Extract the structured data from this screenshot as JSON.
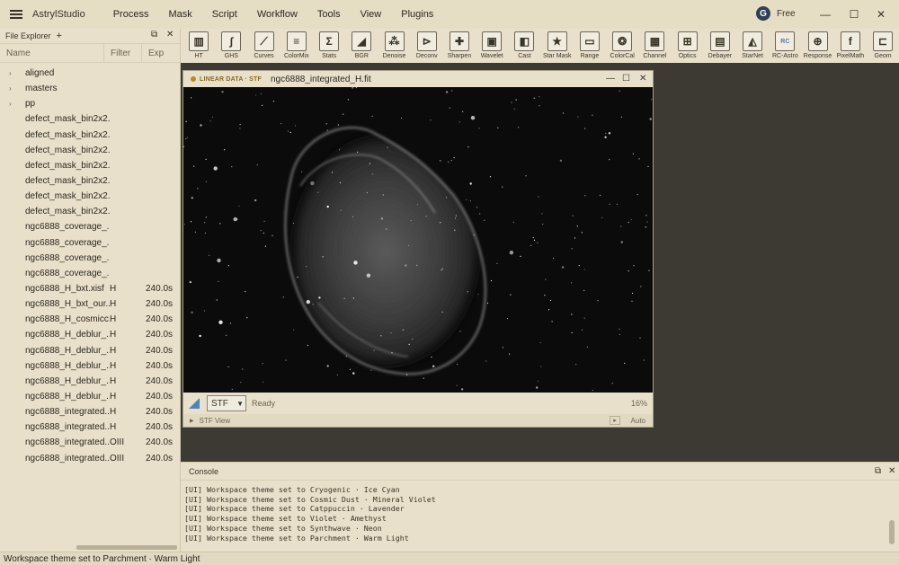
{
  "app": {
    "title": "AstrylStudio"
  },
  "menu": [
    "Process",
    "Mask",
    "Script",
    "Workflow",
    "Tools",
    "View",
    "Plugins"
  ],
  "user": {
    "initial": "G",
    "plan": "Free"
  },
  "window_controls": {
    "minimize": "—",
    "maximize": "☐",
    "close": "✕"
  },
  "file_explorer": {
    "title": "File Explorer",
    "add_icon": "+",
    "columns": {
      "name": "Name",
      "filter": "Filter",
      "exp": "Exp"
    },
    "items": [
      {
        "name": "aligned",
        "folder": true,
        "filter": "",
        "exp": ""
      },
      {
        "name": "masters",
        "folder": true,
        "filter": "",
        "exp": ""
      },
      {
        "name": "pp",
        "folder": true,
        "filter": "",
        "exp": ""
      },
      {
        "name": "defect_mask_bin2x2...",
        "folder": false,
        "filter": "",
        "exp": ""
      },
      {
        "name": "defect_mask_bin2x2...",
        "folder": false,
        "filter": "",
        "exp": ""
      },
      {
        "name": "defect_mask_bin2x2...",
        "folder": false,
        "filter": "",
        "exp": ""
      },
      {
        "name": "defect_mask_bin2x2...",
        "folder": false,
        "filter": "",
        "exp": ""
      },
      {
        "name": "defect_mask_bin2x2...",
        "folder": false,
        "filter": "",
        "exp": ""
      },
      {
        "name": "defect_mask_bin2x2...",
        "folder": false,
        "filter": "",
        "exp": ""
      },
      {
        "name": "defect_mask_bin2x2...",
        "folder": false,
        "filter": "",
        "exp": ""
      },
      {
        "name": "ngc6888_coverage_...",
        "folder": false,
        "filter": "",
        "exp": ""
      },
      {
        "name": "ngc6888_coverage_...",
        "folder": false,
        "filter": "",
        "exp": ""
      },
      {
        "name": "ngc6888_coverage_...",
        "folder": false,
        "filter": "",
        "exp": ""
      },
      {
        "name": "ngc6888_coverage_...",
        "folder": false,
        "filter": "",
        "exp": ""
      },
      {
        "name": "ngc6888_H_bxt.xisf",
        "folder": false,
        "filter": "H",
        "exp": "240.0s"
      },
      {
        "name": "ngc6888_H_bxt_our...",
        "folder": false,
        "filter": "H",
        "exp": "240.0s"
      },
      {
        "name": "ngc6888_H_cosmicc...",
        "folder": false,
        "filter": "H",
        "exp": "240.0s"
      },
      {
        "name": "ngc6888_H_deblur_...",
        "folder": false,
        "filter": "H",
        "exp": "240.0s"
      },
      {
        "name": "ngc6888_H_deblur_...",
        "folder": false,
        "filter": "H",
        "exp": "240.0s"
      },
      {
        "name": "ngc6888_H_deblur_...",
        "folder": false,
        "filter": "H",
        "exp": "240.0s"
      },
      {
        "name": "ngc6888_H_deblur_...",
        "folder": false,
        "filter": "H",
        "exp": "240.0s"
      },
      {
        "name": "ngc6888_H_deblur_...",
        "folder": false,
        "filter": "H",
        "exp": "240.0s"
      },
      {
        "name": "ngc6888_integrated...",
        "folder": false,
        "filter": "H",
        "exp": "240.0s"
      },
      {
        "name": "ngc6888_integrated...",
        "folder": false,
        "filter": "H",
        "exp": "240.0s"
      },
      {
        "name": "ngc6888_integrated...",
        "folder": false,
        "filter": "OIII",
        "exp": "240.0s"
      },
      {
        "name": "ngc6888_integrated...",
        "folder": false,
        "filter": "OIII",
        "exp": "240.0s"
      }
    ]
  },
  "toolbar": [
    {
      "label": "HT",
      "icon": "histogram-icon",
      "glyph": "▥"
    },
    {
      "label": "GHS",
      "icon": "ghs-curve-icon",
      "glyph": "∫"
    },
    {
      "label": "Curves",
      "icon": "curves-icon",
      "glyph": "⟋"
    },
    {
      "label": "ColorMix",
      "icon": "colormix-icon",
      "glyph": "≡"
    },
    {
      "label": "Stats",
      "icon": "sigma-icon",
      "glyph": "Σ"
    },
    {
      "label": "BGR",
      "icon": "gradient-icon",
      "glyph": "◢"
    },
    {
      "label": "Denoise",
      "icon": "denoise-icon",
      "glyph": "⁂"
    },
    {
      "label": "Deconv",
      "icon": "deconv-icon",
      "glyph": "⊳"
    },
    {
      "label": "Sharpen",
      "icon": "sharpen-icon",
      "glyph": "✚"
    },
    {
      "label": "Wavelet",
      "icon": "wavelet-icon",
      "glyph": "▣"
    },
    {
      "label": "Cast",
      "icon": "cast-icon",
      "glyph": "◧"
    },
    {
      "label": "Star Mask",
      "icon": "star-mask-icon",
      "glyph": "★"
    },
    {
      "label": "Range",
      "icon": "range-icon",
      "glyph": "▭"
    },
    {
      "label": "ColorCal",
      "icon": "colorcal-icon",
      "glyph": "❂"
    },
    {
      "label": "Channel",
      "icon": "channel-icon",
      "glyph": "▦"
    },
    {
      "label": "Optics",
      "icon": "optics-icon",
      "glyph": "⊞"
    },
    {
      "label": "Debayer",
      "icon": "debayer-icon",
      "glyph": "▤"
    },
    {
      "label": "StarNet",
      "icon": "starnet-icon",
      "glyph": "◭"
    },
    {
      "label": "RC-Astro",
      "icon": "rc-astro-icon",
      "glyph": "RC"
    },
    {
      "label": "Response",
      "icon": "response-icon",
      "glyph": "⊕"
    },
    {
      "label": "PixelMath",
      "icon": "pixelmath-icon",
      "glyph": "f"
    },
    {
      "label": "Geom",
      "icon": "geometry-icon",
      "glyph": "⊏"
    }
  ],
  "image_window": {
    "badge": "LINEAR DATA · STF",
    "title": "ngc6888_integrated_H.fit",
    "stf_select": "STF",
    "status": "Ready",
    "zoom": "16%",
    "stf_view_label": "STF View",
    "auto_label": "Auto"
  },
  "console": {
    "title": "Console",
    "lines": [
      "[UI] Workspace theme set to Cryogenic · Ice Cyan",
      "[UI] Workspace theme set to Cosmic Dust · Mineral Violet",
      "[UI] Workspace theme set to Catppuccin · Lavender",
      "[UI] Workspace theme set to Violet · Amethyst",
      "[UI] Workspace theme set to Synthwave · Neon",
      "[UI] Workspace theme set to Parchment · Warm Light"
    ]
  },
  "statusbar": {
    "text": "Workspace theme set to Parchment · Warm Light"
  },
  "colors": {
    "accent": "#4f84b9",
    "badge": "#b8892b",
    "workspace": "#3d3a33"
  }
}
